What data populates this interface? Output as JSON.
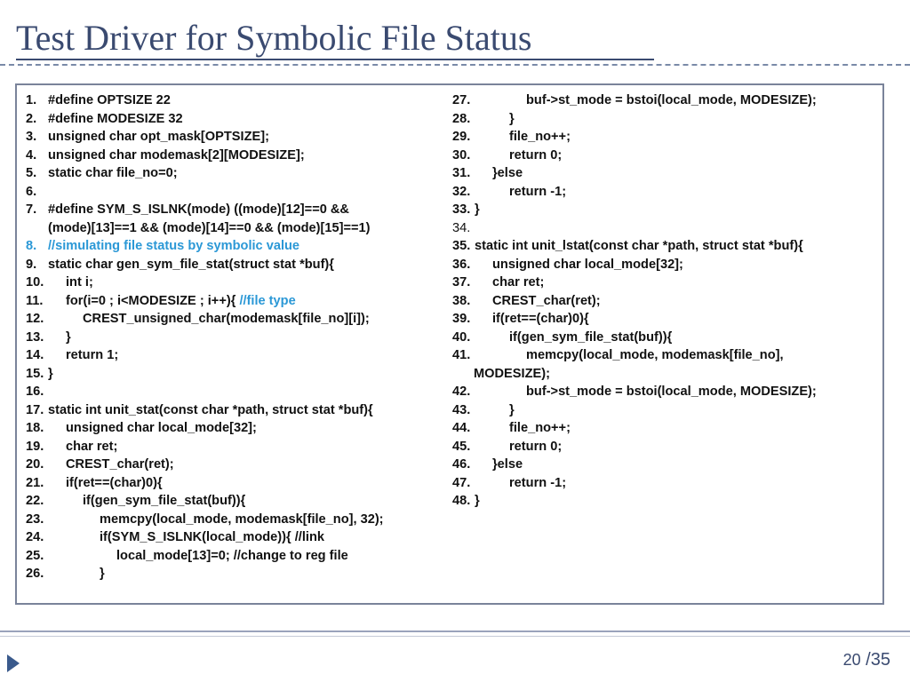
{
  "title": "Test Driver for Symbolic File Status",
  "left_lines": [
    {
      "num": "1.",
      "text": "#define OPTSIZE 22"
    },
    {
      "num": "2.",
      "text": "#define MODESIZE 32"
    },
    {
      "num": "3.",
      "text": "unsigned char opt_mask[OPTSIZE];"
    },
    {
      "num": "4.",
      "text": "unsigned char modemask[2][MODESIZE];"
    },
    {
      "num": "5.",
      "text": "static char file_no=0;"
    },
    {
      "num": "6.",
      "text": ""
    },
    {
      "num": "7.",
      "text": "#define SYM_S_ISLNK(mode) ((mode)[12]==0 &&"
    },
    {
      "num": "",
      "text": "(mode)[13]==1 && (mode)[14]==0 && (mode)[15]==1)"
    },
    {
      "num": "",
      "text": ""
    },
    {
      "num": "8.",
      "text": "//simulating file status by symbolic value"
    },
    {
      "num": "9.",
      "text": "static char gen_sym_file_stat(struct stat *buf){"
    },
    {
      "num": "10.",
      "text": "int i;"
    },
    {
      "num": "11.",
      "text": "for(i=0 ; i<MODESIZE ; i++){ ",
      "comment": "//file type"
    },
    {
      "num": "12.",
      "text": "CREST_unsigned_char(modemask[file_no][i]);"
    },
    {
      "num": "13.",
      "text": "}"
    },
    {
      "num": "14.",
      "text": "return 1;"
    },
    {
      "num": "15.",
      "text": "}"
    },
    {
      "num": "16.",
      "text": ""
    },
    {
      "num": "17.",
      "text": "static int unit_stat(const char *path, struct stat *buf){"
    },
    {
      "num": "18.",
      "text": "unsigned char local_mode[32];"
    },
    {
      "num": "19.",
      "text": "char ret;"
    },
    {
      "num": "20.",
      "text": "CREST_char(ret);"
    },
    {
      "num": "21.",
      "text": "if(ret==(char)0){"
    },
    {
      "num": "22.",
      "text": "if(gen_sym_file_stat(buf)){"
    },
    {
      "num": "23.",
      "text": "memcpy(local_mode, modemask[file_no], 32);"
    },
    {
      "num": "24.",
      "text": "if(SYM_S_ISLNK(local_mode)){ //link"
    },
    {
      "num": "25.",
      "text": "local_mode[13]=0; //change to reg file"
    },
    {
      "num": "26.",
      "text": "}"
    }
  ],
  "right_lines": [
    {
      "num": "27.",
      "text": "buf->st_mode = bstoi(local_mode, MODESIZE);"
    },
    {
      "num": "28.",
      "text": "}"
    },
    {
      "num": "29.",
      "text": "file_no++;"
    },
    {
      "num": "30.",
      "text": "return 0;"
    },
    {
      "num": "31.",
      "text": "}else"
    },
    {
      "num": "32.",
      "text": "return -1;"
    },
    {
      "num": "33.",
      "text": "}"
    },
    {
      "num": "34.",
      "text": ""
    },
    {
      "num": "35.",
      "text": "static int unit_lstat(const char *path, struct stat *buf){"
    },
    {
      "num": "36.",
      "text": "unsigned char local_mode[32];"
    },
    {
      "num": "37.",
      "text": "char ret;"
    },
    {
      "num": "38.",
      "text": "CREST_char(ret);"
    },
    {
      "num": "39.",
      "text": "if(ret==(char)0){"
    },
    {
      "num": "40.",
      "text": "if(gen_sym_file_stat(buf)){"
    },
    {
      "num": "41.",
      "text": "memcpy(local_mode, modemask[file_no],"
    },
    {
      "num": "",
      "text": "MODESIZE);"
    },
    {
      "num": "42.",
      "text": "buf->st_mode = bstoi(local_mode, MODESIZE);"
    },
    {
      "num": "43.",
      "text": "}"
    },
    {
      "num": "44.",
      "text": "file_no++;"
    },
    {
      "num": "45.",
      "text": "return 0;"
    },
    {
      "num": "46.",
      "text": "}else"
    },
    {
      "num": "47.",
      "text": "return -1;"
    },
    {
      "num": "48.",
      "text": "}"
    }
  ],
  "page": {
    "current": "20",
    "separator": " /",
    "total": "35"
  },
  "colors": {
    "title": "#3a4a70",
    "comment": "#2b98d6",
    "border": "#7a839a"
  }
}
